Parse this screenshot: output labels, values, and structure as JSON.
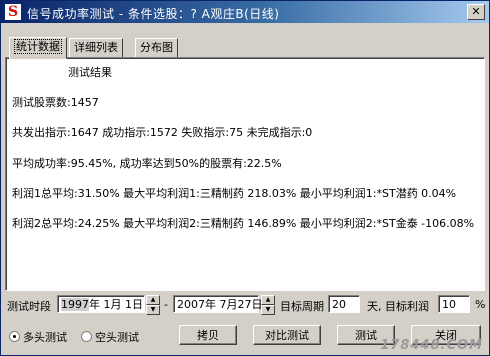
{
  "window": {
    "title": "信号成功率测试 - 条件选股：? A观庄B(日线)",
    "app_icon": "S",
    "close_glyph": "✕"
  },
  "tabs": [
    {
      "label": "统计数据",
      "active": true
    },
    {
      "label": "详细列表",
      "active": false
    },
    {
      "label": "分布图",
      "active": false
    }
  ],
  "results": {
    "title": "测试结果",
    "stock_count": "测试股票数:1457",
    "signals": "共发出指示:1647 成功指示:1572 失败指示:75 未完成指示:0",
    "success_rate": "平均成功率:95.45%, 成功率达到50%的股票有:22.5%",
    "profit1": "利润1总平均:31.50% 最大平均利润1:三精制药 218.03% 最小平均利润1:*ST潜药 0.04%",
    "profit2": "利润2总平均:24.25% 最大平均利润2:三精制药 146.89% 最小平均利润2:*ST金泰 -106.08%"
  },
  "controls": {
    "period_label": "测试时段",
    "start_year": "1997",
    "start_rest": "年  1月  1日",
    "dash": "-",
    "end_date": "2007年  7月27日",
    "target_period_label": "目标周期",
    "target_period_value": "20",
    "target_profit_label": "天, 目标利润",
    "target_profit_value": "10",
    "percent": "%",
    "mode_long": "多头测试",
    "mode_short": "空头测试",
    "mode_selected": "多头测试"
  },
  "buttons": {
    "copy": "拷贝",
    "compare": "对比测试",
    "test": "测试",
    "close": "关闭"
  },
  "watermark": "178448.COM"
}
